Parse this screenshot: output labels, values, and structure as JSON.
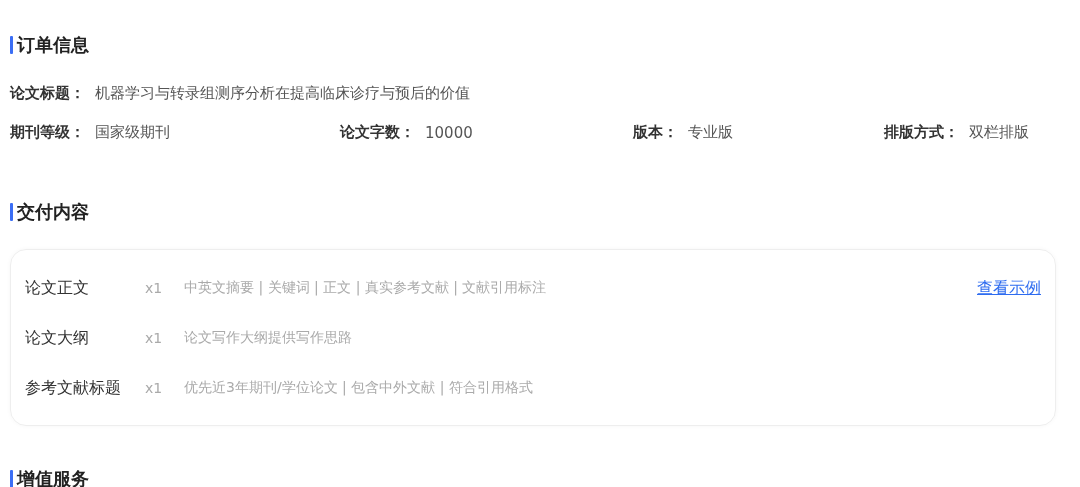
{
  "sections": [
    {
      "heading": "订单信息",
      "title_field": {
        "label": "论文标题：",
        "value": "机器学习与转录组测序分析在提高临床诊疗与预后的价值"
      },
      "fields": [
        {
          "label": "期刊等级：",
          "value": "国家级期刊"
        },
        {
          "label": "论文字数：",
          "value": "10000"
        },
        {
          "label": "版本：",
          "value": "专业版"
        },
        {
          "label": "排版方式：",
          "value": "双栏排版"
        }
      ]
    },
    {
      "heading": "交付内容",
      "items": [
        {
          "name": "论文正文",
          "quantity": "x1",
          "description": "中英文摘要 | 关键词 | 正文 | 真实参考文献 | 文献引用标注",
          "link": "查看示例"
        },
        {
          "name": "论文大纲",
          "quantity": "x1",
          "description": "论文写作大纲提供写作思路"
        },
        {
          "name": "参考文献标题",
          "quantity": "x1",
          "description": "优先近3年期刊/学位论文 | 包含中外文献 | 符合引用格式"
        }
      ]
    },
    {
      "heading": "增值服务"
    }
  ]
}
